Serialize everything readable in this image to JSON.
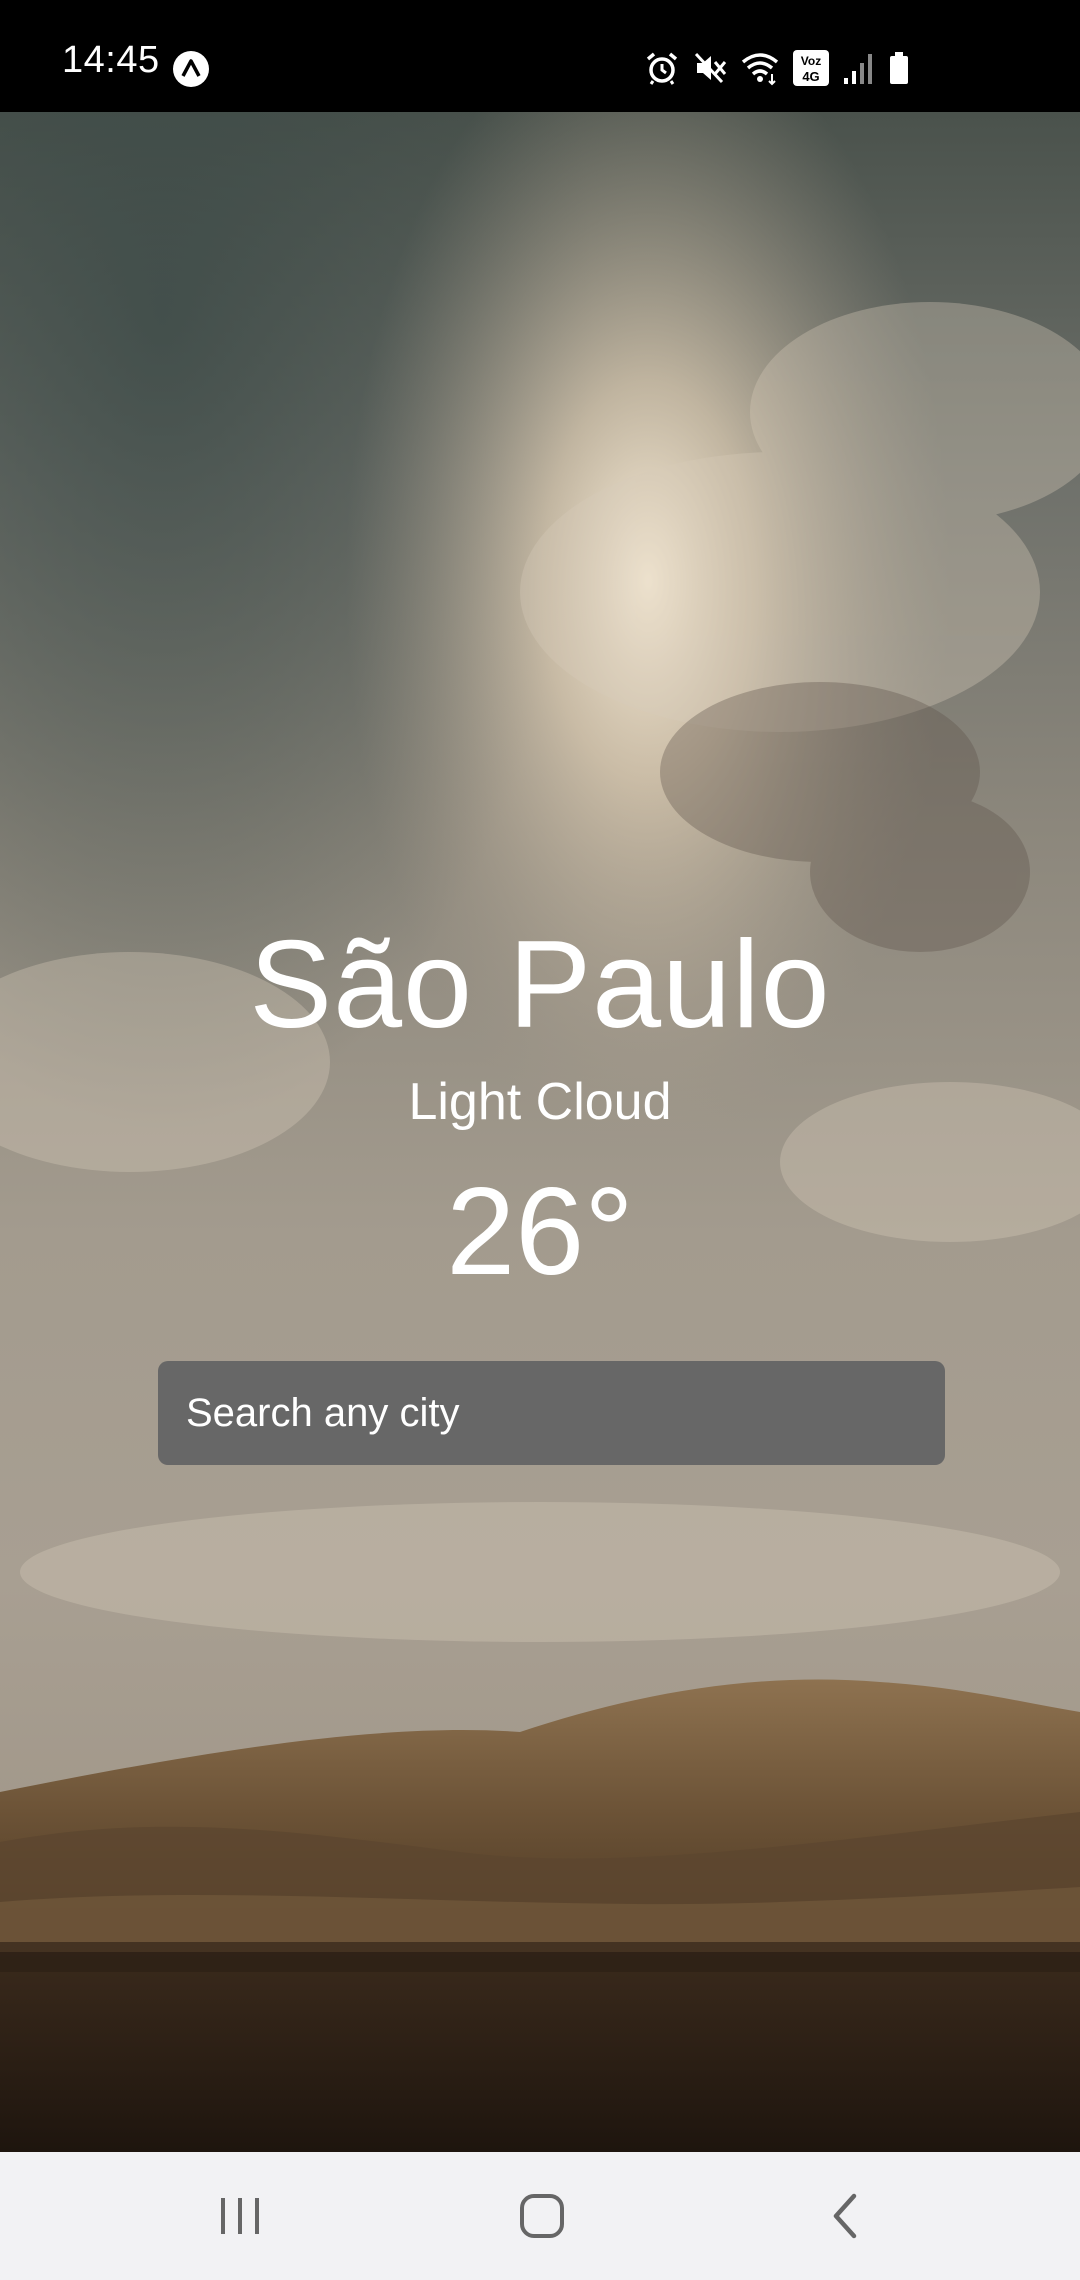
{
  "status_bar": {
    "time": "14:45",
    "icons": [
      "app-notification-icon",
      "alarm-icon",
      "mute-icon",
      "wifi-icon",
      "volte-4g-icon",
      "signal-icon",
      "battery-icon"
    ]
  },
  "weather": {
    "city": "São Paulo",
    "condition": "Light Cloud",
    "temperature": "26°"
  },
  "search": {
    "placeholder": "Search any city",
    "value": ""
  },
  "nav_bar": {
    "buttons": [
      "recents-icon",
      "home-icon",
      "back-icon"
    ]
  },
  "colors": {
    "search_background": "#676767",
    "text": "#ffffff",
    "status_bar": "#000000",
    "nav_bar": "#f2f2f4"
  }
}
